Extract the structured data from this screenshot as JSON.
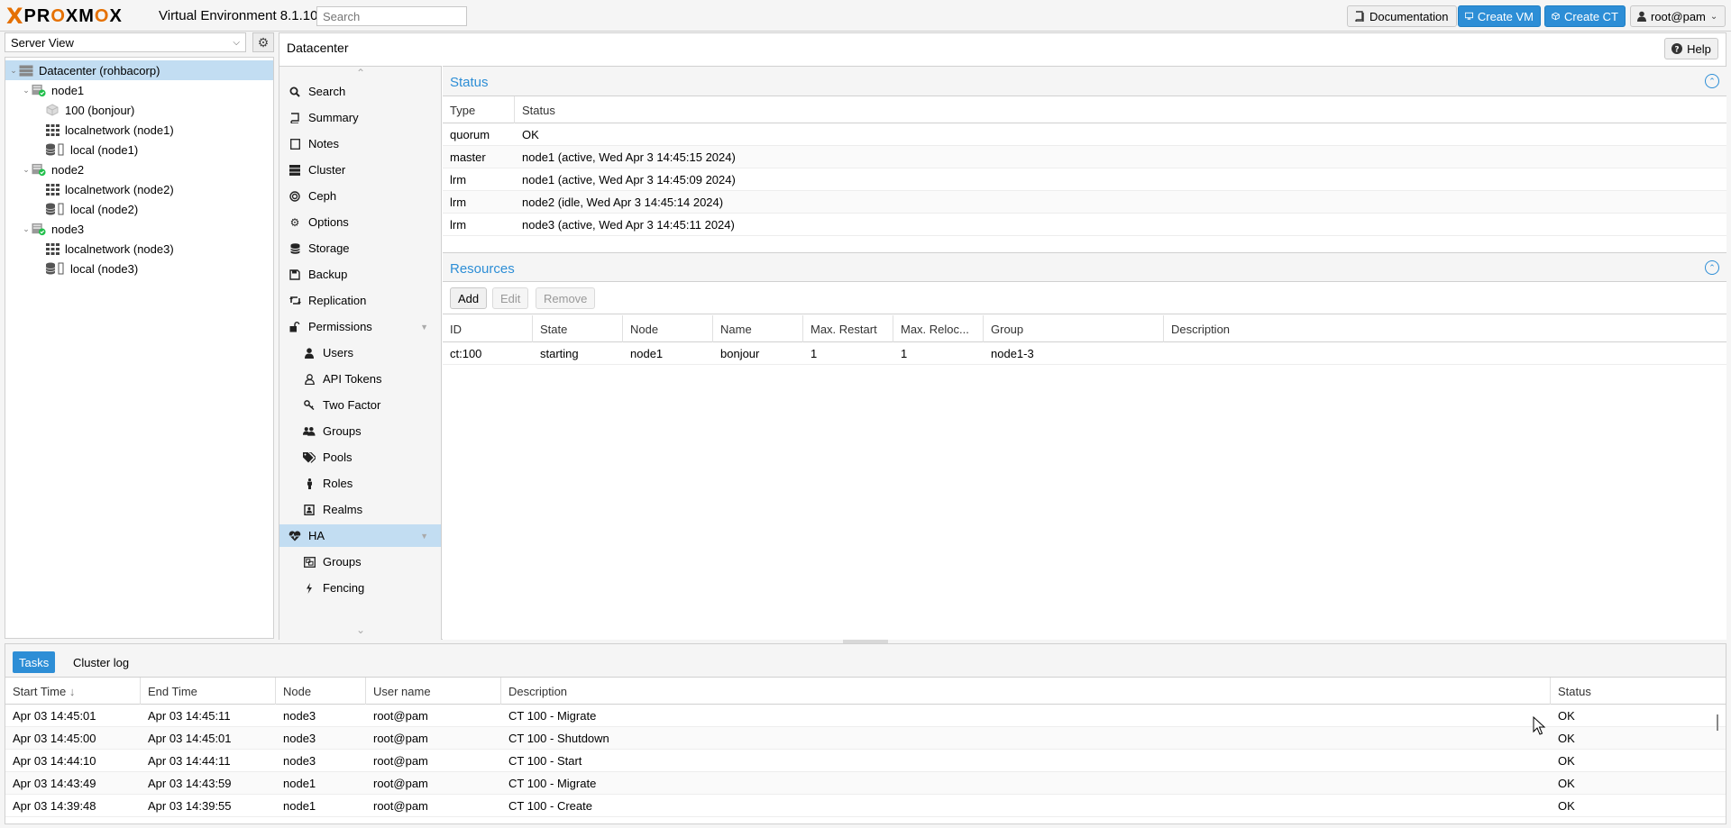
{
  "header": {
    "brand_x": "X",
    "brand_pre": "PR",
    "brand_o1": "O",
    "brand_mid": "XM",
    "brand_o2": "O",
    "brand_post": "X",
    "version": "Virtual Environment 8.1.10",
    "search_placeholder": "Search",
    "documentation": "Documentation",
    "create_vm": "Create VM",
    "create_ct": "Create CT",
    "user": "root@pam"
  },
  "tree": {
    "view": "Server View",
    "items": [
      {
        "label": "Datacenter (rohbacorp)",
        "icon": "datacenter-icon"
      },
      {
        "label": "node1",
        "icon": "node-online-icon"
      },
      {
        "label": "100 (bonjour)",
        "icon": "container-icon"
      },
      {
        "label": "localnetwork (node1)",
        "icon": "network-icon"
      },
      {
        "label": "local (node1)",
        "icon": "storage-icon"
      },
      {
        "label": "node2",
        "icon": "node-online-icon"
      },
      {
        "label": "localnetwork (node2)",
        "icon": "network-icon"
      },
      {
        "label": "local (node2)",
        "icon": "storage-icon"
      },
      {
        "label": "node3",
        "icon": "node-online-icon"
      },
      {
        "label": "localnetwork (node3)",
        "icon": "network-icon"
      },
      {
        "label": "local (node3)",
        "icon": "storage-icon"
      }
    ]
  },
  "main": {
    "title": "Datacenter",
    "help": "Help",
    "menu": [
      {
        "label": "Search",
        "icon": "search-icon"
      },
      {
        "label": "Summary",
        "icon": "book-icon"
      },
      {
        "label": "Notes",
        "icon": "notes-icon"
      },
      {
        "label": "Cluster",
        "icon": "server-icon"
      },
      {
        "label": "Ceph",
        "icon": "ceph-icon"
      },
      {
        "label": "Options",
        "icon": "gear-icon"
      },
      {
        "label": "Storage",
        "icon": "database-icon"
      },
      {
        "label": "Backup",
        "icon": "floppy-icon"
      },
      {
        "label": "Replication",
        "icon": "retweet-icon"
      },
      {
        "label": "Permissions",
        "icon": "unlock-icon"
      },
      {
        "label": "Users",
        "icon": "user-icon"
      },
      {
        "label": "API Tokens",
        "icon": "user-o-icon"
      },
      {
        "label": "Two Factor",
        "icon": "key-icon"
      },
      {
        "label": "Groups",
        "icon": "users-icon"
      },
      {
        "label": "Pools",
        "icon": "tags-icon"
      },
      {
        "label": "Roles",
        "icon": "male-icon"
      },
      {
        "label": "Realms",
        "icon": "address-book-icon"
      },
      {
        "label": "HA",
        "icon": "heartbeat-icon"
      },
      {
        "label": "Groups",
        "icon": "object-group-icon"
      },
      {
        "label": "Fencing",
        "icon": "bolt-icon"
      }
    ],
    "status": {
      "title": "Status",
      "columns": [
        "Type",
        "Status"
      ],
      "rows": [
        [
          "quorum",
          "OK"
        ],
        [
          "master",
          "node1 (active, Wed Apr 3 14:45:15 2024)"
        ],
        [
          "lrm",
          "node1 (active, Wed Apr 3 14:45:09 2024)"
        ],
        [
          "lrm",
          "node2 (idle, Wed Apr 3 14:45:14 2024)"
        ],
        [
          "lrm",
          "node3 (active, Wed Apr 3 14:45:11 2024)"
        ]
      ]
    },
    "resources": {
      "title": "Resources",
      "add": "Add",
      "edit": "Edit",
      "remove": "Remove",
      "columns": [
        "ID",
        "State",
        "Node",
        "Name",
        "Max. Restart",
        "Max. Reloc...",
        "Group",
        "Description"
      ],
      "rows": [
        [
          "ct:100",
          "starting",
          "node1",
          "bonjour",
          "1",
          "1",
          "node1-3",
          ""
        ]
      ]
    }
  },
  "tasks": {
    "tabs": [
      "Tasks",
      "Cluster log"
    ],
    "columns": [
      "Start Time",
      "End Time",
      "Node",
      "User name",
      "Description",
      "Status"
    ],
    "sort_indicator": "↓",
    "rows": [
      [
        "Apr 03 14:45:01",
        "Apr 03 14:45:11",
        "node3",
        "root@pam",
        "CT 100 - Migrate",
        "OK"
      ],
      [
        "Apr 03 14:45:00",
        "Apr 03 14:45:01",
        "node3",
        "root@pam",
        "CT 100 - Shutdown",
        "OK"
      ],
      [
        "Apr 03 14:44:10",
        "Apr 03 14:44:11",
        "node3",
        "root@pam",
        "CT 100 - Start",
        "OK"
      ],
      [
        "Apr 03 14:43:49",
        "Apr 03 14:43:59",
        "node1",
        "root@pam",
        "CT 100 - Migrate",
        "OK"
      ],
      [
        "Apr 03 14:39:48",
        "Apr 03 14:39:55",
        "node1",
        "root@pam",
        "CT 100 - Create",
        "OK"
      ]
    ]
  },
  "colors": {
    "accent": "#2d8ed6",
    "brand": "#e57000",
    "selection": "#c2ddf2",
    "online": "#21bf4b"
  }
}
